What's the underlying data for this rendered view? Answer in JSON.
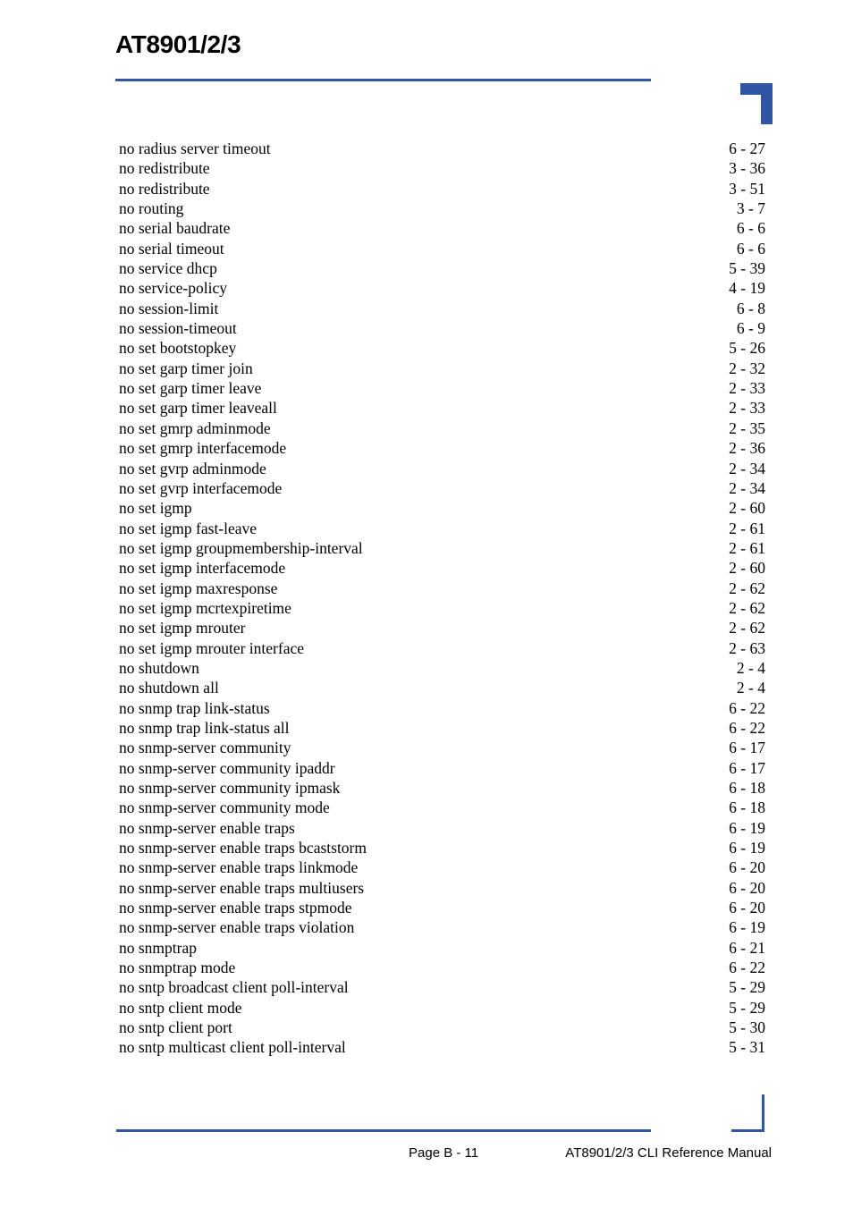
{
  "header": {
    "title": "AT8901/2/3",
    "rule_color": "#2F55A4"
  },
  "index": {
    "entries": [
      {
        "term": "no radius server timeout",
        "page": "6 - 27"
      },
      {
        "term": "no redistribute",
        "page": "3 - 36"
      },
      {
        "term": "no redistribute",
        "page": "3 - 51"
      },
      {
        "term": "no routing",
        "page": "3 - 7"
      },
      {
        "term": "no serial baudrate",
        "page": "6 - 6"
      },
      {
        "term": "no serial timeout",
        "page": "6 - 6"
      },
      {
        "term": "no service dhcp",
        "page": "5 - 39"
      },
      {
        "term": "no service-policy",
        "page": "4 - 19"
      },
      {
        "term": "no session-limit",
        "page": "6 - 8"
      },
      {
        "term": "no session-timeout",
        "page": "6 - 9"
      },
      {
        "term": "no set bootstopkey",
        "page": "5 - 26"
      },
      {
        "term": "no set garp timer join",
        "page": "2 - 32"
      },
      {
        "term": "no set garp timer leave",
        "page": "2 - 33"
      },
      {
        "term": "no set garp timer leaveall",
        "page": "2 - 33"
      },
      {
        "term": "no set gmrp adminmode",
        "page": "2 - 35"
      },
      {
        "term": "no set gmrp interfacemode",
        "page": "2 - 36"
      },
      {
        "term": "no set gvrp adminmode",
        "page": "2 - 34"
      },
      {
        "term": "no set gvrp interfacemode",
        "page": "2 - 34"
      },
      {
        "term": "no set igmp",
        "page": "2 - 60"
      },
      {
        "term": "no set igmp fast-leave",
        "page": "2 - 61"
      },
      {
        "term": "no set igmp groupmembership-interval",
        "page": "2 - 61"
      },
      {
        "term": "no set igmp interfacemode",
        "page": "2 - 60"
      },
      {
        "term": "no set igmp maxresponse",
        "page": "2 - 62"
      },
      {
        "term": "no set igmp mcrtexpiretime",
        "page": "2 - 62"
      },
      {
        "term": "no set igmp mrouter",
        "page": "2 - 62"
      },
      {
        "term": "no set igmp mrouter interface",
        "page": "2 - 63"
      },
      {
        "term": "no shutdown",
        "page": "2 - 4"
      },
      {
        "term": "no shutdown all",
        "page": "2 - 4"
      },
      {
        "term": "no snmp trap link-status",
        "page": "6 - 22"
      },
      {
        "term": "no snmp trap link-status all",
        "page": "6 - 22"
      },
      {
        "term": "no snmp-server community",
        "page": "6 - 17"
      },
      {
        "term": "no snmp-server community ipaddr",
        "page": "6 - 17"
      },
      {
        "term": "no snmp-server community ipmask",
        "page": "6 - 18"
      },
      {
        "term": "no snmp-server community mode",
        "page": "6 - 18"
      },
      {
        "term": "no snmp-server enable traps",
        "page": "6 - 19"
      },
      {
        "term": "no snmp-server enable traps bcaststorm",
        "page": "6 - 19"
      },
      {
        "term": "no snmp-server enable traps linkmode",
        "page": "6 - 20"
      },
      {
        "term": "no snmp-server enable traps multiusers",
        "page": "6 - 20"
      },
      {
        "term": "no snmp-server enable traps stpmode",
        "page": "6 - 20"
      },
      {
        "term": "no snmp-server enable traps violation",
        "page": "6 - 19"
      },
      {
        "term": "no snmptrap",
        "page": "6 - 21"
      },
      {
        "term": "no snmptrap mode",
        "page": "6 - 22"
      },
      {
        "term": "no sntp broadcast client poll-interval",
        "page": "5 - 29"
      },
      {
        "term": "no sntp client mode",
        "page": "5 - 29"
      },
      {
        "term": "no sntp client port",
        "page": "5 - 30"
      },
      {
        "term": "no sntp multicast client poll-interval",
        "page": "5 - 31"
      }
    ]
  },
  "footer": {
    "page_label": "Page B - 11",
    "manual_title": "AT8901/2/3 CLI Reference Manual",
    "rule_color": "#2F55A4"
  }
}
